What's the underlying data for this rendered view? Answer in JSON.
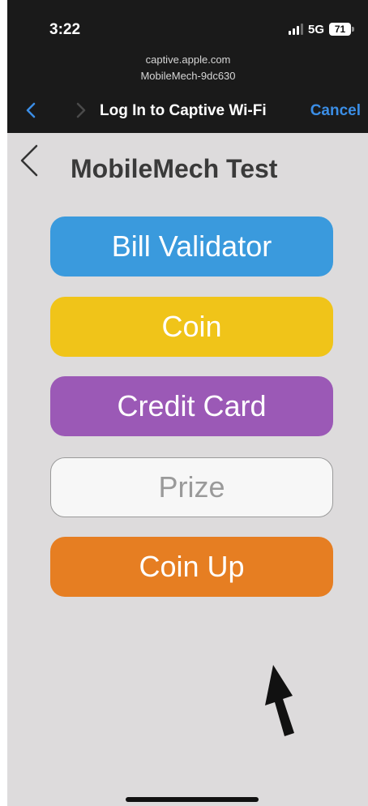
{
  "status_bar": {
    "time": "3:22",
    "network": "5G",
    "battery": "71",
    "signal_bars": 4,
    "signal_bars_filled": 3
  },
  "browser": {
    "url_host": "captive.apple.com",
    "url_subtitle": "MobileMech-9dc630",
    "title": "Log In to Captive Wi-Fi",
    "cancel_label": "Cancel",
    "back_icon": "chevron-left-icon",
    "forward_icon": "chevron-right-icon",
    "accent_color": "#3b8ee6"
  },
  "page": {
    "back_icon": "chevron-left-icon",
    "title": "MobileMech Test",
    "buttons": [
      {
        "label": "Bill Validator",
        "color": "#3a9add"
      },
      {
        "label": "Coin",
        "color": "#f0c419"
      },
      {
        "label": "Credit Card",
        "color": "#9b59b6"
      },
      {
        "label": "Prize",
        "color": "#f7f7f7"
      },
      {
        "label": "Coin Up",
        "color": "#e67e22"
      }
    ],
    "annotation_icon": "arrow-up-icon"
  }
}
